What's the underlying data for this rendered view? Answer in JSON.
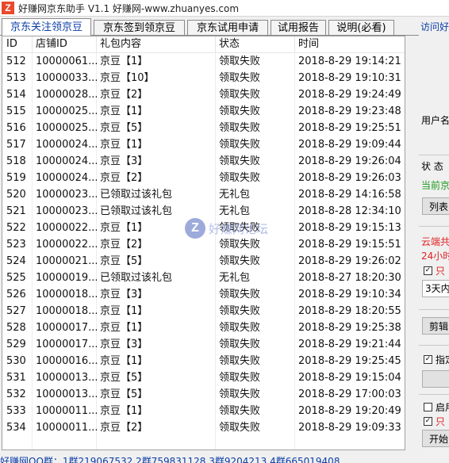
{
  "window": {
    "icon_letter": "Z",
    "title": "好赚网京东助手 V1.1 好赚网-www.zhuanyes.com"
  },
  "tabs": [
    {
      "label": "京东关注领京豆",
      "active": true
    },
    {
      "label": "京东签到领京豆",
      "active": false
    },
    {
      "label": "京东试用申请",
      "active": false
    },
    {
      "label": "试用报告",
      "active": false
    },
    {
      "label": "说明(必看)",
      "active": false
    }
  ],
  "visit_link": "访问好",
  "table": {
    "columns": [
      "ID",
      "店铺ID",
      "礼包内容",
      "状态",
      "时间"
    ],
    "rows": [
      [
        "512",
        "10000061...",
        "京豆【1】",
        "领取失败",
        "2018-8-29 19:14:21"
      ],
      [
        "513",
        "10000033...",
        "京豆【10】",
        "领取失败",
        "2018-8-29 19:10:31"
      ],
      [
        "514",
        "10000028...",
        "京豆【2】",
        "领取失败",
        "2018-8-29 19:24:49"
      ],
      [
        "515",
        "10000025...",
        "京豆【1】",
        "领取失败",
        "2018-8-29 19:23:48"
      ],
      [
        "516",
        "10000025...",
        "京豆【5】",
        "领取失败",
        "2018-8-29 19:25:51"
      ],
      [
        "517",
        "10000024...",
        "京豆【1】",
        "领取失败",
        "2018-8-29 19:09:44"
      ],
      [
        "518",
        "10000024...",
        "京豆【3】",
        "领取失败",
        "2018-8-29 19:26:04"
      ],
      [
        "519",
        "10000024...",
        "京豆【2】",
        "领取失败",
        "2018-8-29 19:26:03"
      ],
      [
        "520",
        "10000023...",
        "已领取过该礼包",
        "无礼包",
        "2018-8-29 14:16:58"
      ],
      [
        "521",
        "10000023...",
        "已领取过该礼包",
        "无礼包",
        "2018-8-28 12:34:10"
      ],
      [
        "522",
        "10000022...",
        "京豆【1】",
        "领取失败",
        "2018-8-29 19:15:13"
      ],
      [
        "523",
        "10000022...",
        "京豆【2】",
        "领取失败",
        "2018-8-29 19:15:51"
      ],
      [
        "524",
        "10000021...",
        "京豆【5】",
        "领取失败",
        "2018-8-29 19:26:02"
      ],
      [
        "525",
        "10000019...",
        "已领取过该礼包",
        "无礼包",
        "2018-8-27 18:20:30"
      ],
      [
        "526",
        "10000018...",
        "京豆【3】",
        "领取失败",
        "2018-8-29 19:10:34"
      ],
      [
        "527",
        "10000018...",
        "京豆【1】",
        "领取失败",
        "2018-8-29 18:20:55"
      ],
      [
        "528",
        "10000017...",
        "京豆【1】",
        "领取失败",
        "2018-8-29 19:25:38"
      ],
      [
        "529",
        "10000017...",
        "京豆【3】",
        "领取失败",
        "2018-8-29 19:21:44"
      ],
      [
        "530",
        "10000016...",
        "京豆【1】",
        "领取失败",
        "2018-8-29 19:25:45"
      ],
      [
        "531",
        "10000013...",
        "京豆【5】",
        "领取失败",
        "2018-8-29 19:15:04"
      ],
      [
        "532",
        "10000013...",
        "京豆【5】",
        "领取失败",
        "2018-8-29 17:00:03"
      ],
      [
        "533",
        "10000011...",
        "京豆【1】",
        "领取失败",
        "2018-8-29 19:20:49"
      ],
      [
        "534",
        "10000011...",
        "京豆【2】",
        "领取失败",
        "2018-8-29 19:09:33"
      ]
    ]
  },
  "watermark": {
    "logo": "Z",
    "text": "好赚网论坛"
  },
  "right_panel": {
    "username_label": "用户名",
    "status_label": "状 态",
    "current_text": "当前京",
    "list_button": "列表",
    "cloud_text": "云端共",
    "hours_text": "24小时",
    "only_check": "只",
    "days_select": "3天内",
    "cut_button": "剪辑",
    "specify_check": "指定",
    "start_check": "启用",
    "only_check2": "只",
    "start_button": "开始"
  },
  "statusbar": {
    "text": "好赚网QQ群：1群219067532  2群759831128  3群9204213  4群665019408"
  },
  "colors": {
    "link": "#0b3ea8",
    "green": "#1f9a1f",
    "red": "#e02020",
    "brand": "#e8492c"
  }
}
